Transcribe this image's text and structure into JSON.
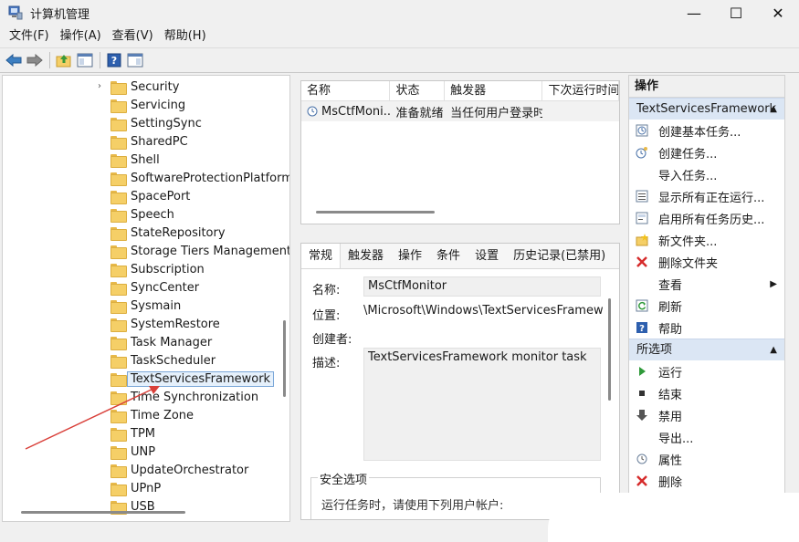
{
  "window": {
    "title": "计算机管理",
    "minimize": "—",
    "maximize": "☐",
    "close": "✕"
  },
  "menu": [
    "文件(F)",
    "操作(A)",
    "查看(V)",
    "帮助(H)"
  ],
  "tree": {
    "items": [
      {
        "label": "Security",
        "expander": "›"
      },
      {
        "label": "Servicing"
      },
      {
        "label": "SettingSync"
      },
      {
        "label": "SharedPC"
      },
      {
        "label": "Shell"
      },
      {
        "label": "SoftwareProtectionPlatform"
      },
      {
        "label": "SpacePort"
      },
      {
        "label": "Speech"
      },
      {
        "label": "StateRepository"
      },
      {
        "label": "Storage Tiers Management"
      },
      {
        "label": "Subscription"
      },
      {
        "label": "SyncCenter"
      },
      {
        "label": "Sysmain"
      },
      {
        "label": "SystemRestore"
      },
      {
        "label": "Task Manager"
      },
      {
        "label": "TaskScheduler"
      },
      {
        "label": "TextServicesFramework",
        "selected": true
      },
      {
        "label": "Time Synchronization"
      },
      {
        "label": "Time Zone"
      },
      {
        "label": "TPM"
      },
      {
        "label": "UNP"
      },
      {
        "label": "UpdateOrchestrator"
      },
      {
        "label": "UPnP"
      },
      {
        "label": "USB"
      }
    ]
  },
  "tasks": {
    "columns": [
      "名称",
      "状态",
      "触发器",
      "下次运行时间"
    ],
    "rows": [
      {
        "name": "MsCtfMoni...",
        "status": "准备就绪",
        "trigger": "当任何用户登录时",
        "next": ""
      }
    ]
  },
  "details": {
    "tabs": [
      "常规",
      "触发器",
      "操作",
      "条件",
      "设置",
      "历史记录(已禁用)"
    ],
    "name_label": "名称:",
    "name_value": "MsCtfMonitor",
    "location_label": "位置:",
    "location_value": "\\Microsoft\\Windows\\TextServicesFramework",
    "author_label": "创建者:",
    "desc_label": "描述:",
    "desc_value": "TextServicesFramework monitor task",
    "security_title": "安全选项",
    "security_text": "运行任务时，请使用下列用户帐户:"
  },
  "actions": {
    "title": "操作",
    "section1": "TextServicesFramework",
    "items1": [
      {
        "icon": "create-basic-task-icon",
        "label": "创建基本任务..."
      },
      {
        "icon": "create-task-icon",
        "label": "创建任务..."
      },
      {
        "icon": "none",
        "label": "导入任务..."
      },
      {
        "icon": "show-running-icon",
        "label": "显示所有正在运行..."
      },
      {
        "icon": "enable-history-icon",
        "label": "启用所有任务历史..."
      },
      {
        "icon": "new-folder-icon",
        "label": "新文件夹..."
      },
      {
        "icon": "delete-folder-icon",
        "label": "删除文件夹"
      },
      {
        "icon": "none",
        "label": "查看",
        "submenu": "▶"
      },
      {
        "icon": "refresh-icon",
        "label": "刷新"
      },
      {
        "icon": "help-icon",
        "label": "帮助"
      }
    ],
    "section2": "所选项",
    "items2": [
      {
        "icon": "run-icon",
        "label": "运行"
      },
      {
        "icon": "end-icon",
        "label": "结束"
      },
      {
        "icon": "disable-icon",
        "label": "禁用"
      },
      {
        "icon": "none",
        "label": "导出..."
      },
      {
        "icon": "properties-icon",
        "label": "属性"
      },
      {
        "icon": "delete-icon",
        "label": "删除"
      }
    ]
  },
  "colors": {
    "accent": "#dbe6f4",
    "arrow": "#d9403a"
  }
}
